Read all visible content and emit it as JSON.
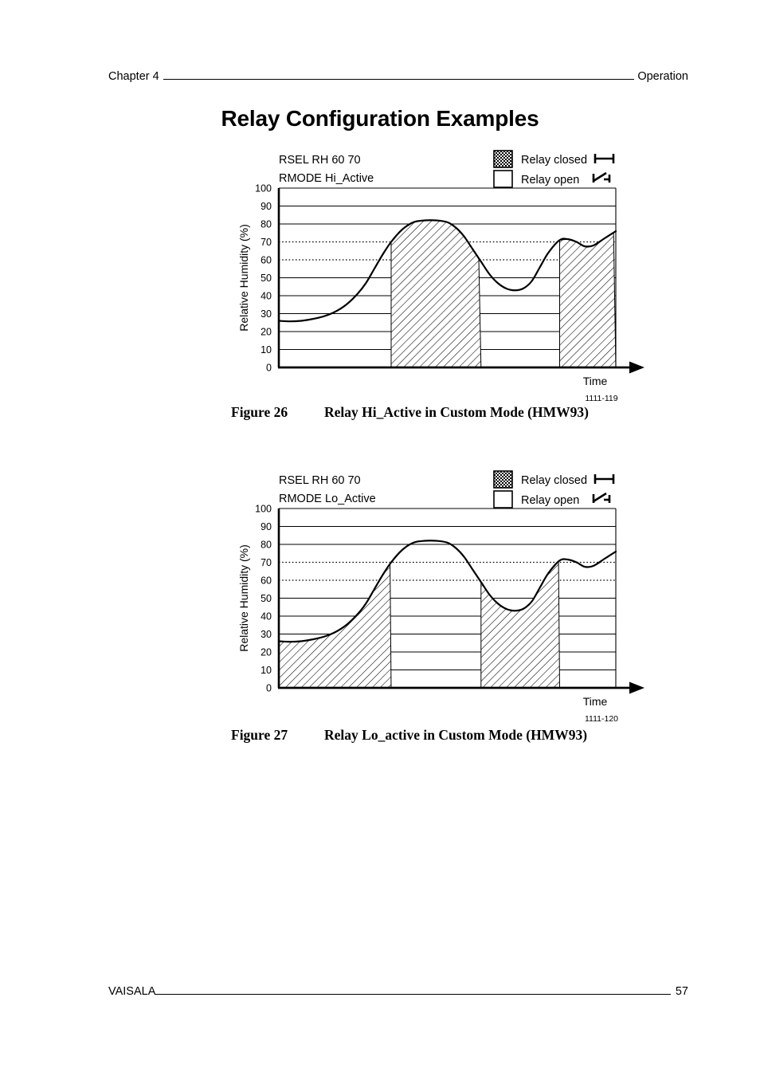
{
  "header": {
    "chapter": "Chapter 4",
    "section": "Operation"
  },
  "title": "Relay Configuration Examples",
  "footer": {
    "brand": "VAISALA",
    "page_number": "57"
  },
  "legend": {
    "closed_label": "Relay closed",
    "open_label": "Relay open",
    "closed_icon": "switch-closed-icon",
    "open_icon": "switch-open-icon"
  },
  "figures": [
    {
      "id": "figure-26",
      "caption_number": "Figure 26",
      "caption_text": "Relay Hi_Active in Custom Mode (HMW93)",
      "code": "1111-119",
      "params": {
        "rsel": "RSEL RH 60 70",
        "rmode": "RMODE Hi_Active"
      },
      "chart_data": {
        "type": "area",
        "title": "Relay Hi_Active in Custom Mode (HMW93)",
        "xlabel": "Time",
        "ylabel": "Relative Humidity (%)",
        "ylim": [
          0,
          100
        ],
        "yticks": [
          0,
          10,
          20,
          30,
          40,
          50,
          60,
          70,
          80,
          90,
          100
        ],
        "solid_gridlines": [
          10,
          20,
          30,
          40,
          50,
          80,
          90,
          100
        ],
        "dotted_gridlines": [
          60,
          70
        ],
        "grid": true,
        "legend_position": "top-right",
        "setpoints": {
          "low": 60,
          "high": 70
        },
        "mode": "Hi_Active",
        "series": [
          {
            "name": "Relative humidity",
            "x": [
              0,
              4,
              8,
              12,
              16,
              20,
              24,
              28,
              31,
              34,
              37,
              40,
              44,
              48,
              52,
              56,
              60,
              63,
              66,
              69,
              72,
              75,
              78,
              81,
              84,
              87,
              90,
              93,
              96,
              100
            ],
            "values": [
              26,
              25.7,
              26,
              27,
              28.5,
              31,
              35,
              41,
              47,
              55,
              63,
              70,
              77,
              81,
              82,
              82,
              81,
              78,
              73,
              66,
              59,
              52,
              47,
              44,
              43,
              44,
              48,
              56,
              64,
              71
            ]
          }
        ],
        "tail": {
          "x": [
            100,
            103,
            106,
            109,
            112,
            116,
            120
          ],
          "values": [
            71,
            71.5,
            70,
            67.5,
            68,
            72,
            76
          ]
        },
        "relay_closed_bands": [
          {
            "x_start": 40,
            "x_end": 72,
            "label": "Relay closed"
          },
          {
            "x_start": 100,
            "x_end": 120,
            "label": "Relay closed"
          }
        ]
      }
    },
    {
      "id": "figure-27",
      "caption_number": "Figure 27",
      "caption_text": "Relay Lo_active in Custom Mode (HMW93)",
      "code": "1111-120",
      "params": {
        "rsel": "RSEL RH 60 70",
        "rmode": "RMODE Lo_Active"
      },
      "chart_data": {
        "type": "area",
        "title": "Relay Lo_active in Custom Mode (HMW93)",
        "xlabel": "Time",
        "ylabel": "Relative Humidity (%)",
        "ylim": [
          0,
          100
        ],
        "yticks": [
          0,
          10,
          20,
          30,
          40,
          50,
          60,
          70,
          80,
          90,
          100
        ],
        "solid_gridlines": [
          10,
          20,
          30,
          40,
          50,
          80,
          90,
          100
        ],
        "dotted_gridlines": [
          60,
          70
        ],
        "grid": true,
        "legend_position": "top-right",
        "setpoints": {
          "low": 60,
          "high": 70
        },
        "mode": "Lo_Active",
        "series": [
          {
            "name": "Relative humidity",
            "x": [
              0,
              4,
              8,
              12,
              16,
              20,
              24,
              28,
              31,
              34,
              37,
              40,
              44,
              48,
              52,
              56,
              60,
              63,
              66,
              69,
              72,
              75,
              78,
              81,
              84,
              87,
              90,
              93,
              96,
              100
            ],
            "values": [
              26,
              25.7,
              26,
              27,
              28.5,
              31,
              35,
              41,
              47,
              55,
              63,
              70,
              77,
              81,
              82,
              82,
              81,
              78,
              73,
              66,
              59,
              52,
              47,
              44,
              43,
              44,
              48,
              56,
              64,
              71
            ]
          }
        ],
        "tail": {
          "x": [
            100,
            103,
            106,
            109,
            112,
            116,
            120
          ],
          "values": [
            71,
            71.5,
            70,
            67.5,
            68,
            72,
            76
          ]
        },
        "relay_closed_bands": [
          {
            "x_start": 0,
            "x_end": 40,
            "label": "Relay closed"
          },
          {
            "x_start": 72,
            "x_end": 100,
            "label": "Relay closed"
          }
        ]
      }
    }
  ]
}
